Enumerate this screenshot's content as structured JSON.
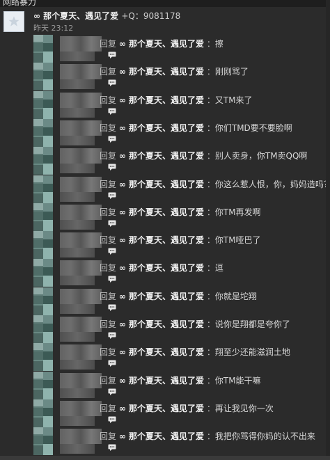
{
  "topbar": {
    "title": "网络暴力"
  },
  "post": {
    "author": "∞ 那个夏天、遇见了爱",
    "qq": "+Q：9081178",
    "time": "昨天 23:12"
  },
  "comments": [
    {
      "reply": "回复",
      "target": "∞ 那个夏天、遇见了爱",
      "text": "擦"
    },
    {
      "reply": "回复",
      "target": "∞ 那个夏天、遇见了爱",
      "text": "刚刚骂了"
    },
    {
      "reply": "回复",
      "target": "∞ 那个夏天、遇见了爱",
      "text": "又TM来了"
    },
    {
      "reply": "回复",
      "target": "∞ 那个夏天、遇见了爱",
      "text": "你们TMD要不要脸啊"
    },
    {
      "reply": "回复",
      "target": "∞ 那个夏天、遇见了爱",
      "text": "别人卖身，你TM卖QQ啊"
    },
    {
      "reply": "回复",
      "target": "∞ 那个夏天、遇见了爱",
      "text": "你这么惹人恨，你，妈妈造吗？"
    },
    {
      "reply": "回复",
      "target": "∞ 那个夏天、遇见了爱",
      "text": "你TM再发啊"
    },
    {
      "reply": "回复",
      "target": "∞ 那个夏天、遇见了爱",
      "text": "你TM哑巴了"
    },
    {
      "reply": "回复",
      "target": "∞ 那个夏天、遇见了爱",
      "text": "逗"
    },
    {
      "reply": "回复",
      "target": "∞ 那个夏天、遇见了爱",
      "text": "你就是坨翔"
    },
    {
      "reply": "回复",
      "target": "∞ 那个夏天、遇见了爱",
      "text": "说你是翔都是夸你了"
    },
    {
      "reply": "回复",
      "target": "∞ 那个夏天、遇见了爱",
      "text": "翔至少还能滋润土地"
    },
    {
      "reply": "回复",
      "target": "∞ 那个夏天、遇见了爱",
      "text": "你TM能干嘛"
    },
    {
      "reply": "回复",
      "target": "∞ 那个夏天、遇见了爱",
      "text": "再让我见你一次"
    },
    {
      "reply": "回复",
      "target": "∞ 那个夏天、遇见了爱",
      "text": "我把你骂得你妈的认不出来"
    }
  ],
  "icons": {
    "avatar": "star-avatar-icon",
    "comment": "comment-bubble-icon"
  }
}
